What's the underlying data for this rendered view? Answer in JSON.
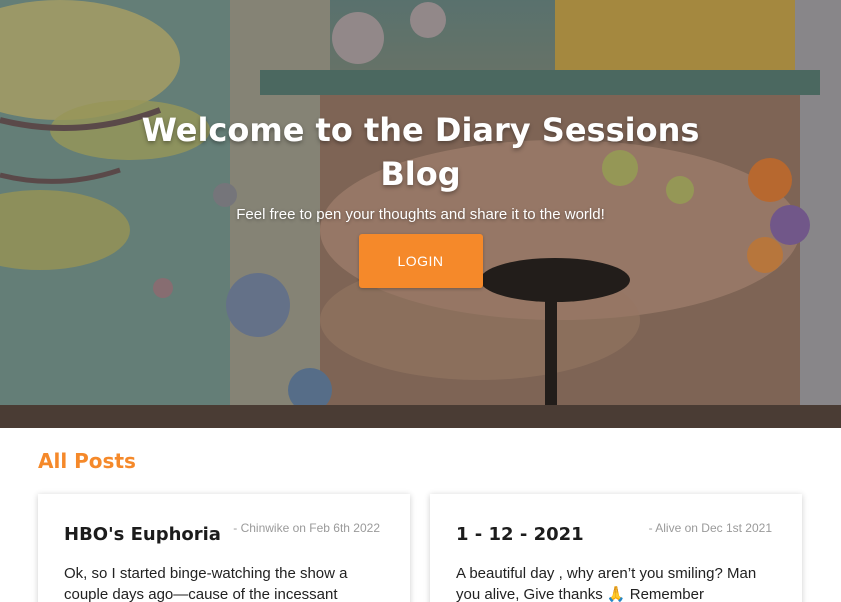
{
  "hero": {
    "title": "Welcome to the Diary Sessions Blog",
    "subtitle": "Feel free to pen your thoughts and share it to the world!",
    "login_label": "LOGIN"
  },
  "posts": {
    "section_title": "All Posts",
    "items": [
      {
        "title": "HBO's Euphoria",
        "meta": "- Chinwike on Feb 6th 2022",
        "excerpt": "Ok, so I started binge-watching the show a couple days ago—cause of the incessant"
      },
      {
        "title": "1 - 12 - 2021",
        "meta": "- Alive on Dec 1st 2021",
        "excerpt": "A beautiful day , why aren’t you smiling? Man you alive, Give thanks 🙏 Remember"
      }
    ]
  },
  "colors": {
    "accent": "#f5892a"
  }
}
